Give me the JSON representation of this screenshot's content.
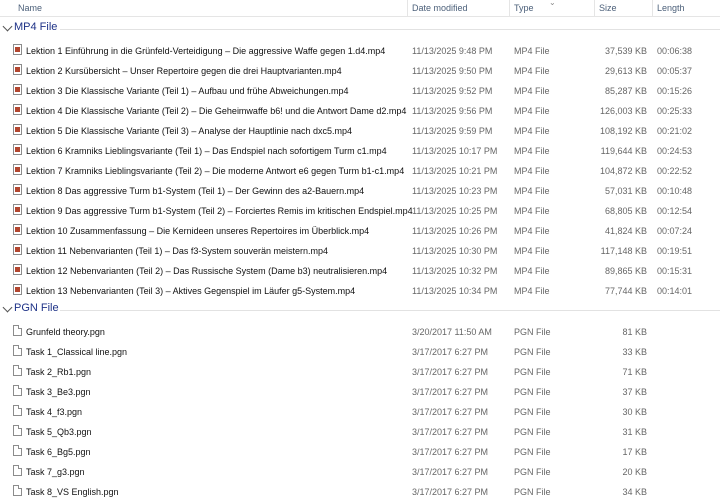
{
  "columns": {
    "name": "Name",
    "date_modified": "Date modified",
    "type": "Type",
    "size": "Size",
    "length": "Length"
  },
  "groups": [
    {
      "title": "MP4 File",
      "files": [
        {
          "name": "Lektion 1 Einführung in die Grünfeld-Verteidigung – Die aggressive Waffe gegen 1.d4.mp4",
          "date": "11/13/2025 9:48 PM",
          "type": "MP4 File",
          "size": "37,539 KB",
          "length": "00:06:38"
        },
        {
          "name": "Lektion 2 Kursübersicht – Unser Repertoire gegen die drei Hauptvarianten.mp4",
          "date": "11/13/2025 9:50 PM",
          "type": "MP4 File",
          "size": "29,613 KB",
          "length": "00:05:37"
        },
        {
          "name": "Lektion 3 Die Klassische Variante (Teil 1) – Aufbau und frühe Abweichungen.mp4",
          "date": "11/13/2025 9:52 PM",
          "type": "MP4 File",
          "size": "85,287 KB",
          "length": "00:15:26"
        },
        {
          "name": "Lektion 4 Die Klassische Variante (Teil 2) – Die Geheimwaffe b6! und die Antwort Dame d2.mp4",
          "date": "11/13/2025 9:56 PM",
          "type": "MP4 File",
          "size": "126,003 KB",
          "length": "00:25:33"
        },
        {
          "name": "Lektion 5 Die Klassische Variante (Teil 3) – Analyse der Hauptlinie nach dxc5.mp4",
          "date": "11/13/2025 9:59 PM",
          "type": "MP4 File",
          "size": "108,192 KB",
          "length": "00:21:02"
        },
        {
          "name": "Lektion 6 Kramniks Lieblingsvariante (Teil 1) – Das Endspiel nach sofortigem Turm c1.mp4",
          "date": "11/13/2025 10:17 PM",
          "type": "MP4 File",
          "size": "119,644 KB",
          "length": "00:24:53"
        },
        {
          "name": "Lektion 7 Kramniks Lieblingsvariante (Teil 2) – Die moderne Antwort e6 gegen Turm b1-c1.mp4",
          "date": "11/13/2025 10:21 PM",
          "type": "MP4 File",
          "size": "104,872 KB",
          "length": "00:22:52"
        },
        {
          "name": "Lektion 8 Das aggressive Turm b1-System (Teil 1) – Der Gewinn des a2-Bauern.mp4",
          "date": "11/13/2025 10:23 PM",
          "type": "MP4 File",
          "size": "57,031 KB",
          "length": "00:10:48"
        },
        {
          "name": "Lektion 9 Das aggressive Turm b1-System (Teil 2) – Forciertes Remis im kritischen Endspiel.mp4",
          "date": "11/13/2025 10:25 PM",
          "type": "MP4 File",
          "size": "68,805 KB",
          "length": "00:12:54"
        },
        {
          "name": "Lektion 10 Zusammenfassung – Die Kernideen unseres Repertoires im Überblick.mp4",
          "date": "11/13/2025 10:26 PM",
          "type": "MP4 File",
          "size": "41,824 KB",
          "length": "00:07:24"
        },
        {
          "name": "Lektion 11 Nebenvarianten (Teil 1) – Das f3-System souverän meistern.mp4",
          "date": "11/13/2025 10:30 PM",
          "type": "MP4 File",
          "size": "117,148 KB",
          "length": "00:19:51"
        },
        {
          "name": "Lektion 12 Nebenvarianten (Teil 2) – Das Russische System (Dame b3) neutralisieren.mp4",
          "date": "11/13/2025 10:32 PM",
          "type": "MP4 File",
          "size": "89,865 KB",
          "length": "00:15:31"
        },
        {
          "name": "Lektion 13 Nebenvarianten (Teil 3) – Aktives Gegenspiel im Läufer g5-System.mp4",
          "date": "11/13/2025 10:34 PM",
          "type": "MP4 File",
          "size": "77,744 KB",
          "length": "00:14:01"
        }
      ]
    },
    {
      "title": "PGN File",
      "files": [
        {
          "name": "Grunfeld theory.pgn",
          "date": "3/20/2017 11:50 AM",
          "type": "PGN File",
          "size": "81 KB",
          "length": ""
        },
        {
          "name": "Task 1_Classical line.pgn",
          "date": "3/17/2017 6:27 PM",
          "type": "PGN File",
          "size": "33 KB",
          "length": ""
        },
        {
          "name": "Task 2_Rb1.pgn",
          "date": "3/17/2017 6:27 PM",
          "type": "PGN File",
          "size": "71 KB",
          "length": ""
        },
        {
          "name": "Task 3_Be3.pgn",
          "date": "3/17/2017 6:27 PM",
          "type": "PGN File",
          "size": "37 KB",
          "length": ""
        },
        {
          "name": "Task 4_f3.pgn",
          "date": "3/17/2017 6:27 PM",
          "type": "PGN File",
          "size": "30 KB",
          "length": ""
        },
        {
          "name": "Task 5_Qb3.pgn",
          "date": "3/17/2017 6:27 PM",
          "type": "PGN File",
          "size": "31 KB",
          "length": ""
        },
        {
          "name": "Task 6_Bg5.pgn",
          "date": "3/17/2017 6:27 PM",
          "type": "PGN File",
          "size": "17 KB",
          "length": ""
        },
        {
          "name": "Task 7_g3.pgn",
          "date": "3/17/2017 6:27 PM",
          "type": "PGN File",
          "size": "20 KB",
          "length": ""
        },
        {
          "name": "Task 8_VS English.pgn",
          "date": "3/17/2017 6:27 PM",
          "type": "PGN File",
          "size": "34 KB",
          "length": ""
        }
      ]
    }
  ]
}
